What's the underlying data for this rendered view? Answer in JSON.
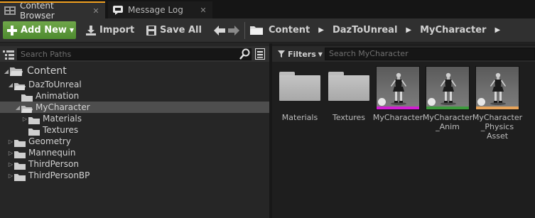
{
  "tabs": [
    {
      "label": "Content Browser",
      "icon": "content-browser-icon",
      "close": "✕",
      "active": true
    },
    {
      "label": "Message Log",
      "icon": "message-log-icon",
      "close": "✕",
      "active": false
    }
  ],
  "toolbar": {
    "add_new": "Add New",
    "import": "Import",
    "save_all": "Save All"
  },
  "breadcrumbs": [
    "Content",
    "DazToUnreal",
    "MyCharacter"
  ],
  "left_panel": {
    "search_placeholder": "Search Paths"
  },
  "tree": [
    {
      "label": "Content",
      "level": 0,
      "expanded": true,
      "selected": false,
      "big": true
    },
    {
      "label": "DazToUnreal",
      "level": 1,
      "expanded": true,
      "selected": false
    },
    {
      "label": "Animation",
      "level": 2,
      "expanded": false,
      "leaf": true,
      "selected": false
    },
    {
      "label": "MyCharacter",
      "level": 2,
      "expanded": true,
      "selected": true
    },
    {
      "label": "Materials",
      "level": 3,
      "expanded": false,
      "selected": false
    },
    {
      "label": "Textures",
      "level": 3,
      "leaf": true,
      "selected": false
    },
    {
      "label": "Geometry",
      "level": 1,
      "expanded": false,
      "selected": false
    },
    {
      "label": "Mannequin",
      "level": 1,
      "expanded": false,
      "selected": false
    },
    {
      "label": "ThirdPerson",
      "level": 1,
      "expanded": false,
      "selected": false
    },
    {
      "label": "ThirdPersonBP",
      "level": 1,
      "expanded": false,
      "selected": false
    }
  ],
  "right_panel": {
    "filters_label": "Filters",
    "search_placeholder": "Search MyCharacter"
  },
  "assets": [
    {
      "label": "Materials",
      "type": "folder"
    },
    {
      "label": "Textures",
      "type": "folder"
    },
    {
      "label": "MyCharacter",
      "type": "skeletal-mesh",
      "strip_color": "#d21ed2"
    },
    {
      "label": "MyCharacter_Anim",
      "type": "anim-blueprint",
      "strip_color": "#3c9a3c"
    },
    {
      "label": "MyCharacter_Physics Asset",
      "type": "physics-asset",
      "strip_color": "#e8a45a"
    }
  ],
  "colors": {
    "accent_orange": "#f0a020",
    "add_new_green": "#5d9a3a",
    "selection": "#4e4e4e"
  }
}
